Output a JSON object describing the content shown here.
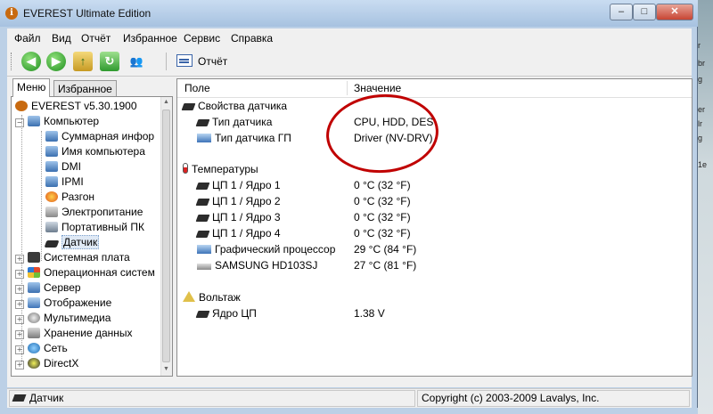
{
  "window": {
    "title": "EVEREST Ultimate Edition",
    "minimize": "–",
    "maximize": "□",
    "close": "✕"
  },
  "desktop_fragments": [
    "r",
    "br",
    "g",
    "er",
    "lr",
    "g",
    "1e"
  ],
  "menu": [
    "Файл",
    "Вид",
    "Отчёт",
    "Избранное",
    "Сервис",
    "Справка"
  ],
  "toolbar": {
    "back": "◀",
    "forward": "▶",
    "up": "↑",
    "refresh": "↻",
    "users": "👥",
    "report_label": "Отчёт"
  },
  "tabs": [
    "Меню",
    "Избранное"
  ],
  "tree": {
    "root": "EVEREST v5.30.1900",
    "computer": "Компьютер",
    "computer_children": [
      "Суммарная инфор",
      "Имя компьютера",
      "DMI",
      "IPMI",
      "Разгон",
      "Электропитание",
      "Портативный ПК",
      "Датчик"
    ],
    "categories": [
      "Системная плата",
      "Операционная систем",
      "Сервер",
      "Отображение",
      "Мультимедиа",
      "Хранение данных",
      "Сеть",
      "DirectX"
    ]
  },
  "columns": {
    "field": "Поле",
    "value": "Значение"
  },
  "groups": [
    {
      "title": "Свойства датчика",
      "rows": [
        {
          "field": "Тип датчика",
          "value": "CPU, HDD, DES"
        },
        {
          "field": "Тип датчика ГП",
          "value": "Driver  (NV-DRV)"
        }
      ]
    },
    {
      "title": "Температуры",
      "rows": [
        {
          "field": "ЦП 1 / Ядро 1",
          "value": "0 °C  (32 °F)"
        },
        {
          "field": "ЦП 1 / Ядро 2",
          "value": "0 °C  (32 °F)"
        },
        {
          "field": "ЦП 1 / Ядро 3",
          "value": "0 °C  (32 °F)"
        },
        {
          "field": "ЦП 1 / Ядро 4",
          "value": "0 °C  (32 °F)"
        },
        {
          "field": "Графический процессор",
          "value": "29 °C  (84 °F)"
        },
        {
          "field": "SAMSUNG HD103SJ",
          "value": "27 °C  (81 °F)"
        }
      ]
    },
    {
      "title": "Вольтаж",
      "rows": [
        {
          "field": "Ядро ЦП",
          "value": "1.38 V"
        }
      ]
    }
  ],
  "status": {
    "left": "Датчик",
    "right": "Copyright (c) 2003-2009 Lavalys, Inc."
  },
  "colors": {
    "frame": "#bcd0e6",
    "selection": "#dfe9f5",
    "annotation": "#c00000"
  }
}
